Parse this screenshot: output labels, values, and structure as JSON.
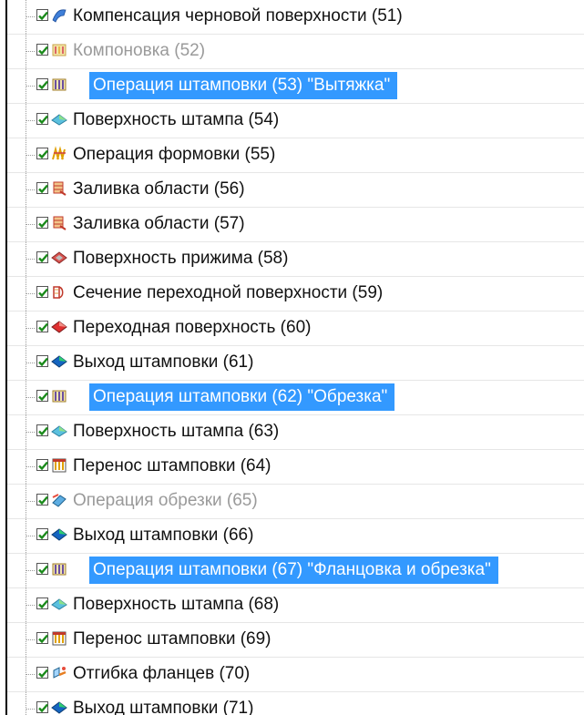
{
  "tree": {
    "items": [
      {
        "label": "Компенсация черновой поверхности (51)",
        "icon": "surface-compensation-icon",
        "state": "normal",
        "checked": true
      },
      {
        "label": "Компоновка (52)",
        "icon": "layout-icon",
        "state": "dim",
        "checked": true
      },
      {
        "label": "Операция штамповки (53) \"Вытяжка\"",
        "icon": "stamping-operation-icon",
        "state": "selected",
        "checked": true
      },
      {
        "label": "Поверхность штампа (54)",
        "icon": "die-surface-icon",
        "state": "normal",
        "checked": true
      },
      {
        "label": "Операция формовки (55)",
        "icon": "forming-operation-icon",
        "state": "normal",
        "checked": true
      },
      {
        "label": "Заливка области (56)",
        "icon": "area-fill-icon",
        "state": "normal",
        "checked": true
      },
      {
        "label": "Заливка области (57)",
        "icon": "area-fill-icon",
        "state": "normal",
        "checked": true
      },
      {
        "label": "Поверхность прижима (58)",
        "icon": "binder-surface-icon",
        "state": "normal",
        "checked": true
      },
      {
        "label": "Сечение переходной поверхности (59)",
        "icon": "transition-section-icon",
        "state": "normal",
        "checked": true
      },
      {
        "label": "Переходная поверхность (60)",
        "icon": "transition-surface-icon",
        "state": "normal",
        "checked": true
      },
      {
        "label": "Выход штамповки (61)",
        "icon": "stamping-output-icon",
        "state": "normal",
        "checked": true
      },
      {
        "label": "Операция штамповки (62) \"Обрезка\"",
        "icon": "stamping-operation-icon",
        "state": "selected",
        "checked": true
      },
      {
        "label": "Поверхность штампа (63)",
        "icon": "die-surface-icon",
        "state": "normal",
        "checked": true
      },
      {
        "label": "Перенос штамповки (64)",
        "icon": "stamping-transfer-icon",
        "state": "normal",
        "checked": true
      },
      {
        "label": "Операция обрезки (65)",
        "icon": "trim-operation-icon",
        "state": "dim",
        "checked": true
      },
      {
        "label": "Выход штамповки (66)",
        "icon": "stamping-output-icon",
        "state": "normal",
        "checked": true
      },
      {
        "label": "Операция штамповки (67) \"Фланцовка и обрезка\"",
        "icon": "stamping-operation-icon",
        "state": "selected",
        "checked": true
      },
      {
        "label": "Поверхность штампа (68)",
        "icon": "die-surface-icon",
        "state": "normal",
        "checked": true
      },
      {
        "label": "Перенос штамповки (69)",
        "icon": "stamping-transfer-icon",
        "state": "normal",
        "checked": true
      },
      {
        "label": "Отгибка фланцев (70)",
        "icon": "flange-bend-icon",
        "state": "normal",
        "checked": true
      },
      {
        "label": "Выход штамповки (71)",
        "icon": "stamping-output-icon",
        "state": "normal",
        "checked": true
      }
    ]
  },
  "colors": {
    "selection": "#3399ff",
    "dim_text": "#9a9a9a",
    "check": "#1a8a1a"
  }
}
